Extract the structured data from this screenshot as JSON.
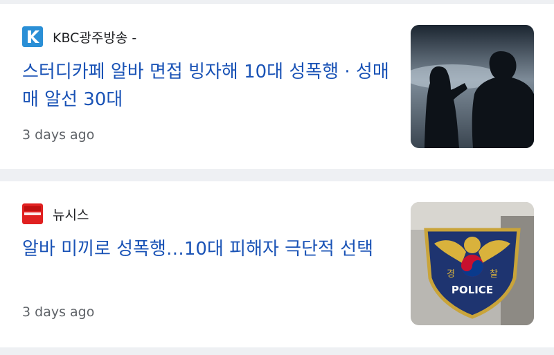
{
  "articles": [
    {
      "source": "KBC광주방송 -",
      "source_logo_icon": "kbc-logo-icon",
      "headline": "스터디카페 알바 면접 빙자해 10대 성폭행 · 성매매 알선 30대",
      "time": "3 days ago",
      "thumbnail_icon": "silhouette-thumbnail"
    },
    {
      "source": "뉴시스",
      "source_logo_icon": "newsis-logo-icon",
      "headline": "알바 미끼로 성폭행…10대 피해자 극단적 선택",
      "time": "3 days ago",
      "thumbnail_icon": "police-emblem-thumbnail",
      "thumbnail_text": {
        "kyung": "경",
        "chal": "찰",
        "police": "POLICE"
      }
    }
  ],
  "colors": {
    "headline": "#1a53b6",
    "background": "#eef0f3",
    "kbc_logo": "#2a8fd6",
    "newsis_logo": "#e02020"
  }
}
